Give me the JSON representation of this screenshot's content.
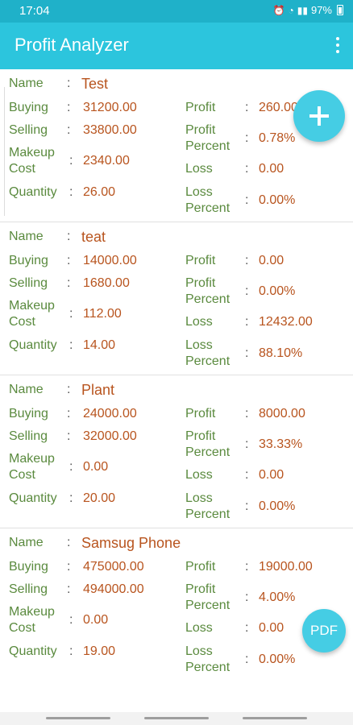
{
  "status_bar": {
    "time": "17:04",
    "battery": "97%",
    "icons": [
      "alarm-icon",
      "wifi-icon",
      "signal-icon",
      "battery-icon"
    ]
  },
  "app_bar": {
    "title": "Profit Analyzer",
    "menu_icon": "overflow-menu-icon"
  },
  "labels": {
    "name": "Name",
    "buying": "Buying",
    "selling": "Selling",
    "makeup_1": "Makeup",
    "makeup_2": "Cost",
    "quantity": "Quantity",
    "profit": "Profit",
    "profit_percent_1": "Profit",
    "profit_percent_2": "Percent",
    "loss": "Loss",
    "loss_percent_1": "Loss",
    "loss_percent_2": "Percent",
    "separator": ":"
  },
  "items": [
    {
      "name": "Test",
      "buying": "31200.00",
      "selling": "33800.00",
      "makeup": "2340.00",
      "quantity": "26.00",
      "profit": "260.00",
      "profit_percent": "0.78%",
      "loss": "0.00",
      "loss_percent": "0.00%"
    },
    {
      "name": "teat",
      "buying": "14000.00",
      "selling": "1680.00",
      "makeup": "112.00",
      "quantity": "14.00",
      "profit": "0.00",
      "profit_percent": "0.00%",
      "loss": "12432.00",
      "loss_percent": "88.10%"
    },
    {
      "name": "Plant",
      "buying": "24000.00",
      "selling": "32000.00",
      "makeup": "0.00",
      "quantity": "20.00",
      "profit": "8000.00",
      "profit_percent": "33.33%",
      "loss": "0.00",
      "loss_percent": "0.00%"
    },
    {
      "name": "Samsug Phone",
      "buying": "475000.00",
      "selling": "494000.00",
      "makeup": "0.00",
      "quantity": "19.00",
      "profit": "19000.00",
      "profit_percent": "4.00%",
      "loss": "0.00",
      "loss_percent": "0.00%"
    }
  ],
  "fab_add": {
    "icon": "plus-icon"
  },
  "fab_pdf": {
    "label": "PDF"
  },
  "colors": {
    "status_bar": "#1fb1c9",
    "app_bar": "#2cc5dd",
    "fab": "#45cde4",
    "label": "#5a8a3e",
    "value": "#b8541e"
  }
}
